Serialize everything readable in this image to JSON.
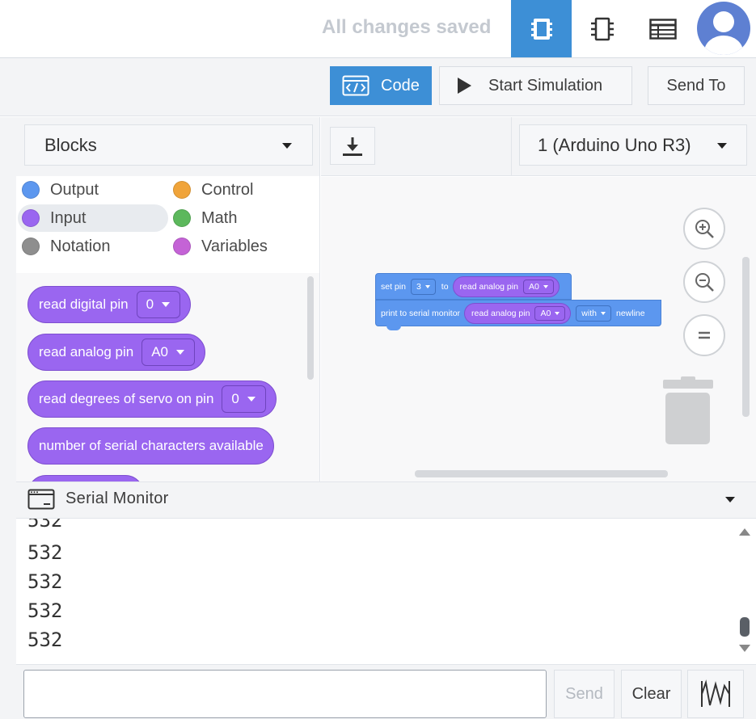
{
  "header": {
    "save_status": "All changes saved",
    "view_tabs": [
      "code-view-icon",
      "schematic-icon",
      "component-list-icon"
    ],
    "active_tab_color": "#3d8fd6"
  },
  "toolbar": {
    "code_label": "Code",
    "simulation_label": "Start Simulation",
    "send_to_label": "Send To"
  },
  "blocks_panel": {
    "mode_select": "Blocks",
    "categories": [
      {
        "label": "Output",
        "color": "#5c97ef"
      },
      {
        "label": "Control",
        "color": "#f0a43a"
      },
      {
        "label": "Input",
        "color": "#9a66f0"
      },
      {
        "label": "Math",
        "color": "#5cb85c"
      },
      {
        "label": "Notation",
        "color": "#8e8e8e"
      },
      {
        "label": "Variables",
        "color": "#c463d6"
      }
    ],
    "selected_category": "Input",
    "palette_blocks": [
      {
        "label": "read digital pin",
        "value": "0"
      },
      {
        "label": "read analog pin",
        "value": "A0"
      },
      {
        "label": "read degrees of servo on pin",
        "value": "0"
      },
      {
        "label": "number of serial characters available"
      }
    ]
  },
  "workspace": {
    "board_select": "1 (Arduino Uno R3)",
    "script": {
      "set_pin": {
        "prefix": "set pin",
        "pin": "3",
        "to": "to",
        "reporter": "read analog pin",
        "reporter_value": "A0"
      },
      "print": {
        "prefix": "print to serial monitor",
        "reporter": "read analog pin",
        "reporter_value": "A0",
        "mode": "with",
        "suffix": "newline"
      }
    }
  },
  "serial_monitor": {
    "title": "Serial Monitor",
    "lines": [
      "532",
      "532",
      "532",
      "532",
      "532"
    ],
    "input_value": "",
    "send_label": "Send",
    "clear_label": "Clear"
  }
}
